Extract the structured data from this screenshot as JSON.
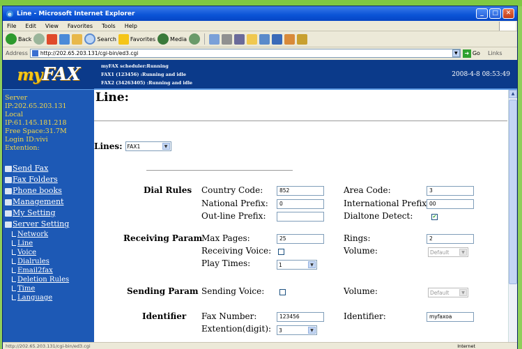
{
  "window": {
    "title": "Line - Microsoft Internet Explorer"
  },
  "menubar": [
    "File",
    "Edit",
    "View",
    "Favorites",
    "Tools",
    "Help"
  ],
  "toolbar": {
    "back": "Back",
    "search": "Search",
    "favorites": "Favorites",
    "media": "Media"
  },
  "address": {
    "label": "Address",
    "url": "http://202.65.203.131/cgi-bin/ed3.cgi",
    "go": "Go",
    "links": "Links"
  },
  "header": {
    "logo_my": "my",
    "logo_fax": "FAX",
    "status_lines": [
      "myFAX scheduler:Running",
      "FAX1 (123456)     :Running and idle",
      "FAX2 (34263405) :Running and idle"
    ],
    "datetime": "2008-4-8 08:53:49"
  },
  "sidebar": {
    "info": [
      "Server",
      "IP:202.65.203.131",
      "Local",
      "IP:61.145.181.218",
      "Free Space:31.7M",
      "Login ID:vivi",
      "Extention:"
    ],
    "menu": [
      {
        "label": "Send Fax",
        "icon": "send-fax-icon"
      },
      {
        "label": "Fax Folders",
        "icon": "folder-icon"
      },
      {
        "label": "Phone books",
        "icon": "phonebook-icon"
      },
      {
        "label": "Management",
        "icon": "management-icon"
      },
      {
        "label": "My Setting",
        "icon": "my-setting-icon"
      },
      {
        "label": "Server Setting",
        "icon": "server-setting-icon"
      }
    ],
    "submenu": [
      "Network",
      "Line",
      "Voice",
      "Dialrules",
      "Email2fax",
      "Deletion Rules",
      "Time",
      "Language"
    ]
  },
  "content": {
    "title": "Line:",
    "lines_label": "Lines:",
    "lines_value": "FAX1",
    "dial_rules": {
      "section": "Dial Rules",
      "country_code_label": "Country Code:",
      "country_code": "852",
      "area_code_label": "Area Code:",
      "area_code": "3",
      "national_prefix_label": "National Prefix:",
      "national_prefix": "0",
      "international_prefix_label": "International Prefix:",
      "international_prefix": "00",
      "outline_prefix_label": "Out-line Prefix:",
      "outline_prefix": "",
      "dialtone_label": "Dialtone Detect:",
      "dialtone_checked": true
    },
    "receiving": {
      "section": "Receiving Param",
      "max_pages_label": "Max Pages:",
      "max_pages": "25",
      "rings_label": "Rings:",
      "rings": "2",
      "voice_label": "Receiving Voice:",
      "voice_checked": false,
      "volume_label": "Volume:",
      "volume": "Default",
      "play_times_label": "Play Times:",
      "play_times": "1"
    },
    "sending": {
      "section": "Sending Param",
      "voice_label": "Sending Voice:",
      "voice_checked": false,
      "volume_label": "Volume:",
      "volume": "Default"
    },
    "identifier": {
      "section": "Identifier",
      "fax_number_label": "Fax Number:",
      "fax_number": "123456",
      "identifier_label": "Identifier:",
      "identifier": "myfaxoa",
      "extention_label": "Extention(digit):",
      "extention": "3"
    }
  },
  "statusbar": {
    "url": "http://202.65.203.131/cgi-bin/ed3.cgi",
    "zone": "Internet"
  }
}
